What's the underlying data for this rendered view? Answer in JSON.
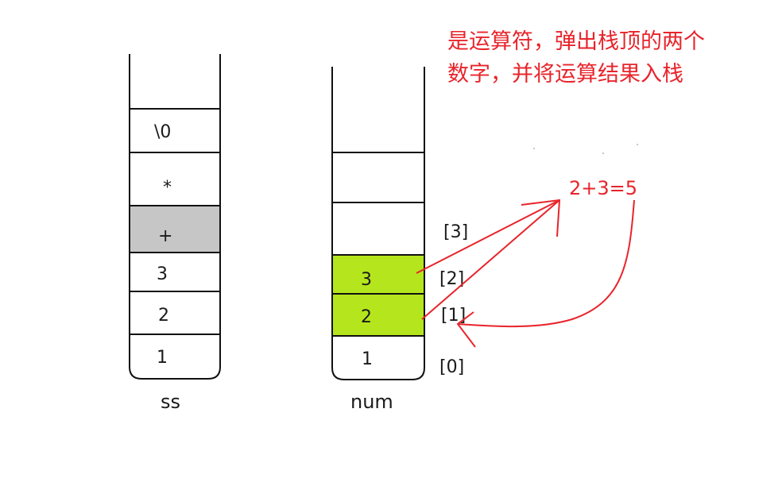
{
  "colors": {
    "stroke": "#111111",
    "highlight_gray": "#c6c6c6",
    "highlight_green": "#b5e61d",
    "annotation_red": "#e8242b"
  },
  "ss_stack": {
    "label": "ss",
    "cells": [
      {
        "text": "\\0"
      },
      {
        "text": "*"
      },
      {
        "text": "+",
        "highlight": "gray"
      },
      {
        "text": "3"
      },
      {
        "text": "2"
      },
      {
        "text": "1"
      }
    ]
  },
  "num_stack": {
    "label": "num",
    "cells": [
      {
        "text": ""
      },
      {
        "text": ""
      },
      {
        "text": "3",
        "highlight": "green"
      },
      {
        "text": "2",
        "highlight": "green"
      },
      {
        "text": "1"
      }
    ],
    "indices": [
      "[3]",
      "[2]",
      "[1]",
      "[0]"
    ]
  },
  "annotation": {
    "line1": "是运算符，弹出栈顶的两个",
    "line2": "数字，并将运算结果入栈",
    "equation": "2+3=5"
  }
}
